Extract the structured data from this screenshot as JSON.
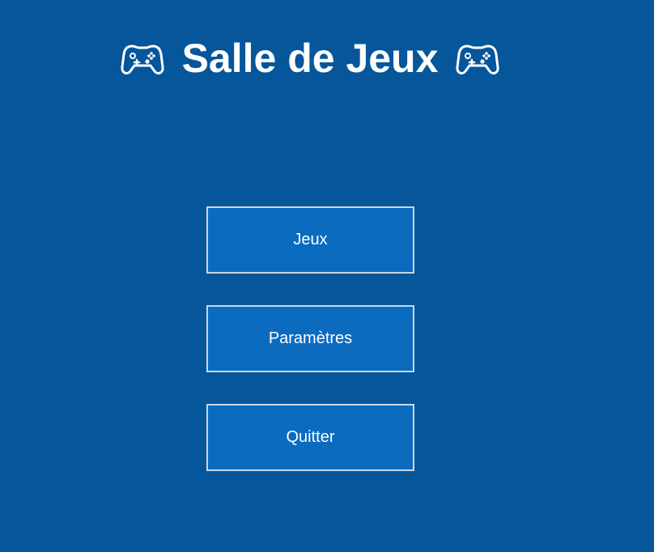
{
  "header": {
    "title": "Salle de Jeux",
    "left_icon": "gamepad-icon",
    "right_icon": "gamepad-icon"
  },
  "menu": {
    "items": [
      {
        "label": "Jeux"
      },
      {
        "label": "Paramètres"
      },
      {
        "label": "Quitter"
      }
    ]
  },
  "colors": {
    "background": "#06569b",
    "button_fill": "#0b6bbf",
    "button_border": "#c9d7e6",
    "text": "#ffffff"
  }
}
